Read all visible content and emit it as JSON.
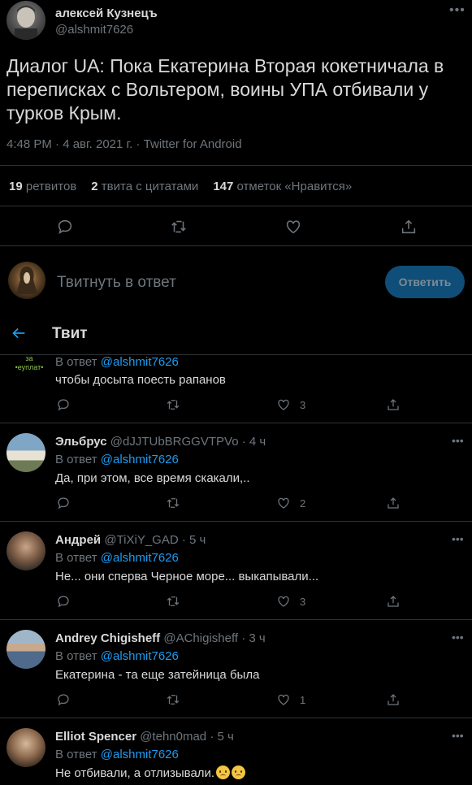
{
  "tweet": {
    "author_name": "алексей Кузнецъ",
    "author_handle": "@alshmit7626",
    "text": "Диалог UA: Пока Екатерина Вторая кокетничала в переписках с Вольтером, воины УПА отбивали у турков Крым.",
    "meta": "4:48 PM · 4 авг. 2021 г. · Twitter for Android",
    "more_icon": "•••",
    "stats": [
      {
        "number": "19",
        "label": "ретвитов"
      },
      {
        "number": "2",
        "label": "твита с цитатами"
      },
      {
        "number": "147",
        "label": "отметок «Нравится»"
      }
    ]
  },
  "composer": {
    "placeholder": "Твитнуть в ответ",
    "button": "Ответить"
  },
  "header": {
    "title": "Твит"
  },
  "replies": [
    {
      "avatar_text": "за\n•еуплат•",
      "reply_prefix": "В ответ",
      "reply_handle": "@alshmit7626",
      "text": "чтобы досыта поесть рапанов",
      "likes": "3"
    },
    {
      "name": "Эльбрус",
      "handle": "@dJJTUbBRGGVTPVo",
      "time": "· 4 ч",
      "reply_prefix": "В ответ",
      "reply_handle": "@alshmit7626",
      "text": "Да, при этом, все время скакали,..",
      "likes": "2"
    },
    {
      "name": "Андрей",
      "handle": "@TiXiY_GAD",
      "time": "· 5 ч",
      "reply_prefix": "В ответ",
      "reply_handle": "@alshmit7626",
      "text": "Не... они сперва Черное море... выкапывали...",
      "likes": "3"
    },
    {
      "name": "Andrey Chigisheff",
      "handle": "@AChigisheff",
      "time": "· 3 ч",
      "reply_prefix": "В ответ",
      "reply_handle": "@alshmit7626",
      "text": "Екатерина - та еще затейница была",
      "likes": "1"
    },
    {
      "name": "Elliot Spencer",
      "handle": "@tehn0mad",
      "time": "· 5 ч",
      "reply_prefix": "В ответ",
      "reply_handle": "@alshmit7626",
      "text": "Не отбивали, а отлизывали."
    }
  ],
  "colors": {
    "background": "#000000",
    "link": "#1d9bf0",
    "muted": "#6e767d",
    "button": "#0f4e78"
  }
}
